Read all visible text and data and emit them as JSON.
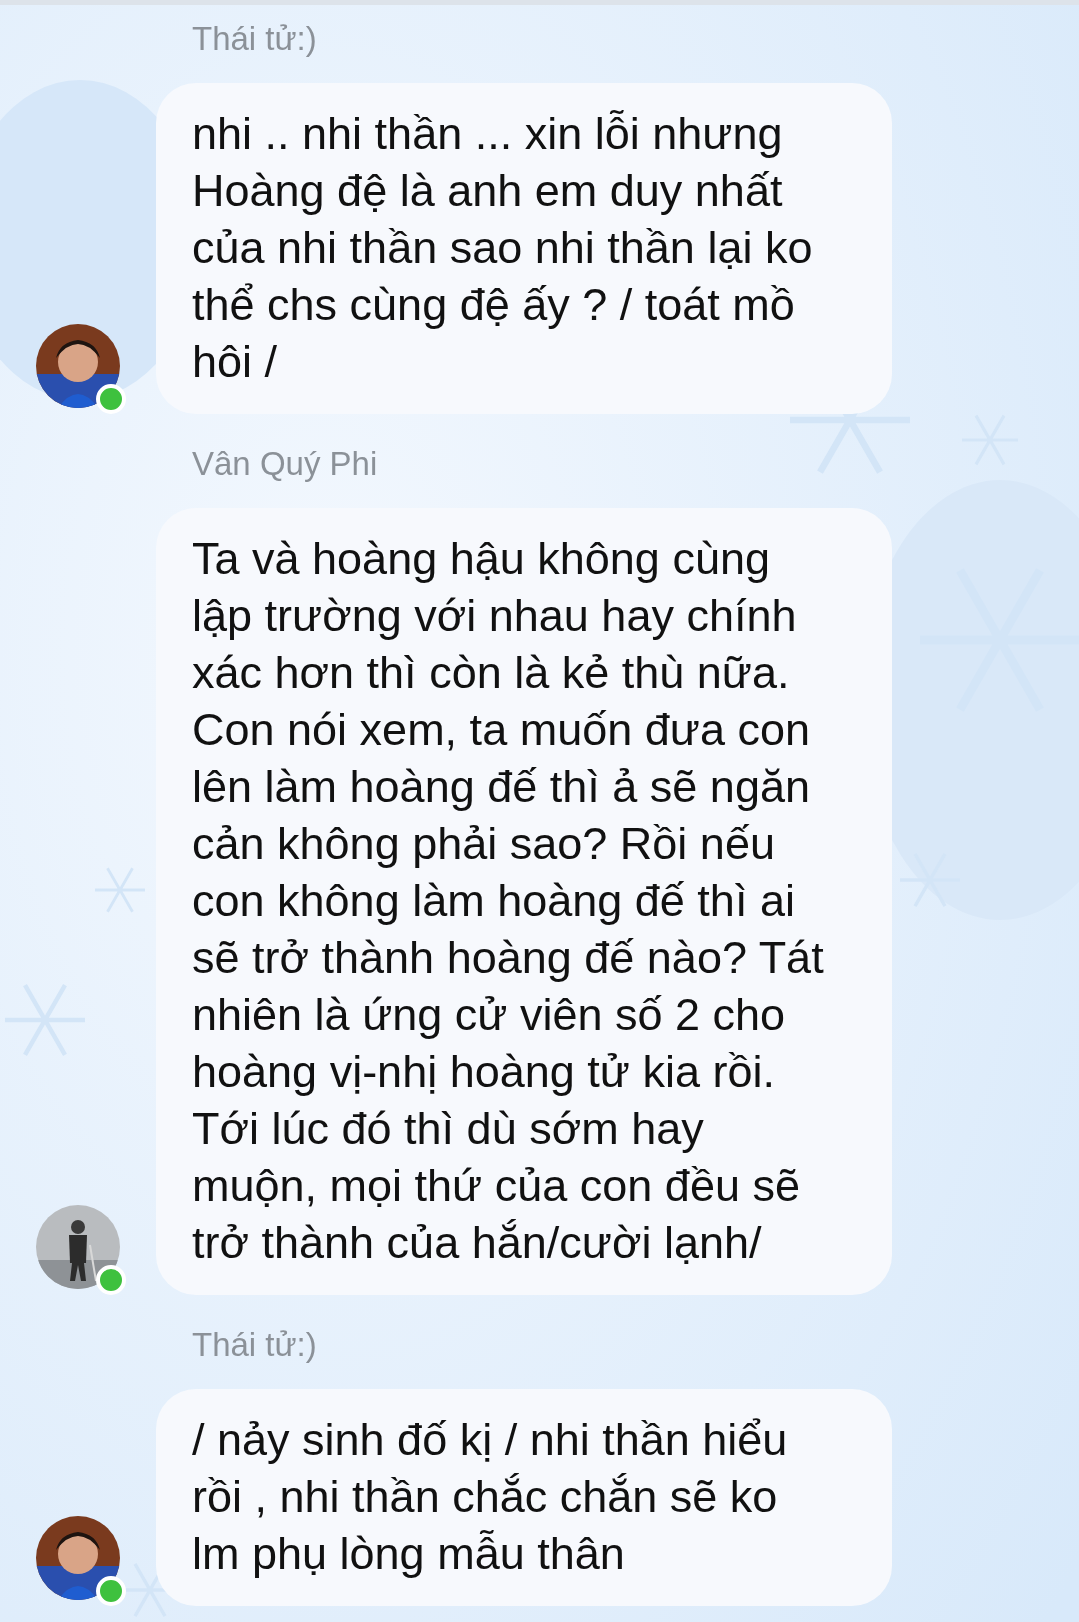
{
  "messages": [
    {
      "sender": "Thái tử:)",
      "avatar": {
        "kind": "portrait"
      },
      "online": true,
      "lines": [
        "nhi .. nhi thần ... xin lỗi nhưng",
        "Hoàng đệ là anh em duy nhất",
        "của nhi thần sao nhi thần lại ko",
        "thể chs cùng đệ ấy ? / toát mồ",
        "hôi /"
      ]
    },
    {
      "sender": "Vân Quý Phi",
      "avatar": {
        "kind": "scene"
      },
      "online": true,
      "lines": [
        "Ta và hoàng hậu không cùng",
        "lập trường với nhau hay chính",
        "xác hơn thì còn là kẻ thù nữa.",
        "Con nói xem, ta muốn đưa con",
        "lên làm hoàng đế thì ả sẽ ngăn",
        "cản không phải sao? Rồi nếu",
        "con không làm hoàng đế thì ai",
        "sẽ trở thành hoàng đế nào? Tát",
        "nhiên là ứng cử viên số 2 cho",
        "hoàng vị-nhị hoàng tử kia rồi.",
        "Tới lúc đó thì dù sớm hay",
        "muộn, mọi thứ của con đều sẽ",
        "trở thành của hắn/cười lạnh/"
      ]
    },
    {
      "sender": "Thái tử:)",
      "avatar": {
        "kind": "portrait"
      },
      "online": true,
      "lines": [
        "/ nảy sinh đố kị / nhi thần hiểu",
        "rồi , nhi thần chắc chắn sẽ ko",
        "lm phụ lòng mẫu thân"
      ]
    }
  ]
}
